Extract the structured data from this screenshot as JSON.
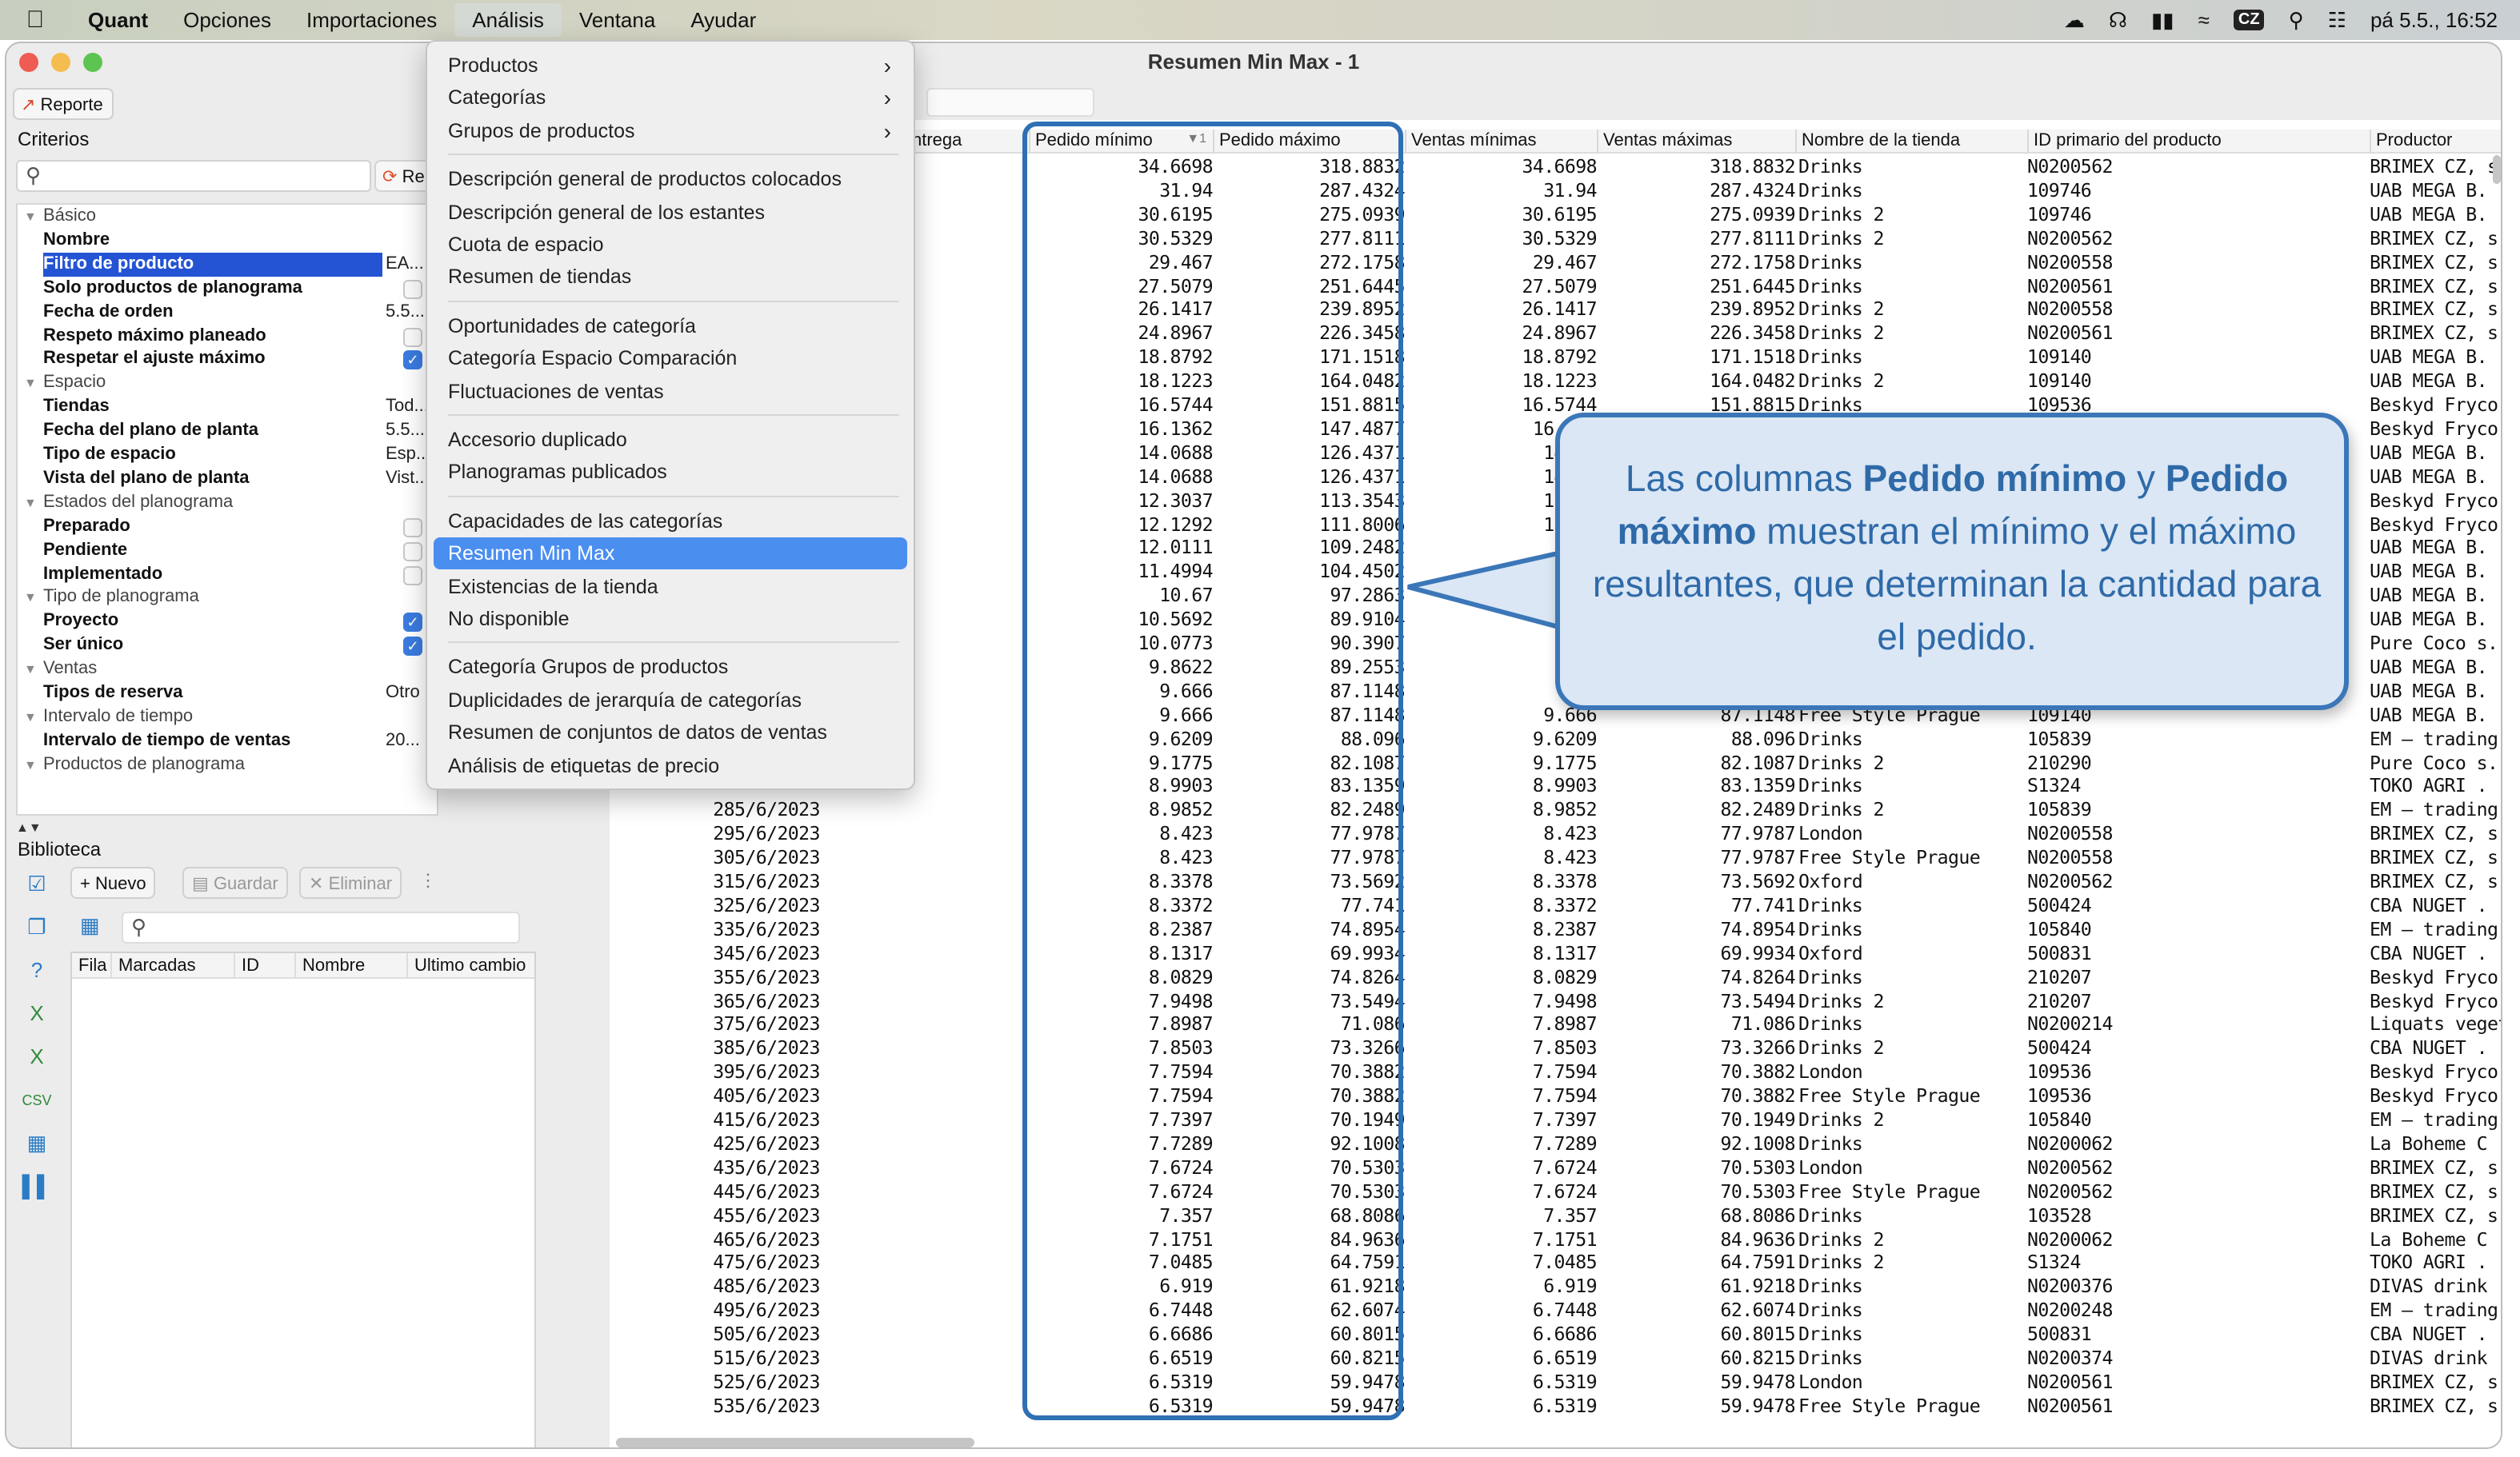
{
  "menubar": {
    "app": "Quant",
    "items": [
      "Opciones",
      "Importaciones",
      "Análisis",
      "Ventana",
      "Ayudar"
    ],
    "active_index": 2,
    "clock": "pá 5.5., 16:52",
    "lang": "CZ"
  },
  "window": {
    "title": "Resumen Min Max - 1",
    "report_button": "Reporte"
  },
  "criteria": {
    "title": "Criterios",
    "re_button": "Re",
    "rows": [
      {
        "type": "group",
        "label": "Básico"
      },
      {
        "type": "item",
        "label": "Nombre",
        "value": ""
      },
      {
        "type": "item",
        "label": "Filtro de producto",
        "value": "EA...",
        "selected": true
      },
      {
        "type": "item",
        "label": "Solo productos de planograma",
        "check": "off"
      },
      {
        "type": "item",
        "label": "Fecha de orden",
        "value": "5.5...."
      },
      {
        "type": "item",
        "label": "Respeto máximo planeado",
        "check": "off"
      },
      {
        "type": "item",
        "label": "Respetar el ajuste máximo",
        "check": "on"
      },
      {
        "type": "group",
        "label": "Espacio"
      },
      {
        "type": "item",
        "label": "Tiendas",
        "value": "Tod..."
      },
      {
        "type": "item",
        "label": "Fecha del plano de planta",
        "value": "5.5...."
      },
      {
        "type": "item",
        "label": "Tipo de espacio",
        "value": "Esp..."
      },
      {
        "type": "item",
        "label": "Vista del plano de planta",
        "value": "Vist..."
      },
      {
        "type": "group",
        "label": "Estados del planograma"
      },
      {
        "type": "item",
        "label": "Preparado",
        "check": "off"
      },
      {
        "type": "item",
        "label": "Pendiente",
        "check": "off"
      },
      {
        "type": "item",
        "label": "Implementado",
        "check": "off"
      },
      {
        "type": "group",
        "label": "Tipo de planograma"
      },
      {
        "type": "item",
        "label": "Proyecto",
        "check": "on"
      },
      {
        "type": "item",
        "label": "Ser único",
        "check": "on"
      },
      {
        "type": "group",
        "label": "Ventas"
      },
      {
        "type": "item",
        "label": "Tipos de reserva",
        "value": "Otro"
      },
      {
        "type": "group",
        "label": "Intervalo de tiempo"
      },
      {
        "type": "item",
        "label": "Intervalo de tiempo de ventas",
        "value": "20..."
      },
      {
        "type": "group",
        "label": "Productos de planograma"
      }
    ]
  },
  "library": {
    "title": "Biblioteca",
    "new_label": "Nuevo",
    "save_label": "Guardar",
    "delete_label": "Eliminar",
    "columns": [
      "Fila",
      "Marcadas",
      "ID",
      "Nombre",
      "Ultimo cambio"
    ]
  },
  "menu": {
    "groups": [
      [
        {
          "label": "Productos",
          "sub": true
        },
        {
          "label": "Categorías",
          "sub": true
        },
        {
          "label": "Grupos de productos",
          "sub": true
        }
      ],
      [
        {
          "label": "Descripción general de productos colocados"
        },
        {
          "label": "Descripción general de los estantes"
        },
        {
          "label": "Cuota de espacio"
        },
        {
          "label": "Resumen de tiendas"
        }
      ],
      [
        {
          "label": "Oportunidades de categoría"
        },
        {
          "label": "Categoría Espacio Comparación"
        },
        {
          "label": "Fluctuaciones de ventas"
        }
      ],
      [
        {
          "label": "Accesorio duplicado"
        },
        {
          "label": "Planogramas publicados"
        }
      ],
      [
        {
          "label": "Capacidades de las categorías"
        },
        {
          "label": "Resumen Min Max",
          "highlight": true
        },
        {
          "label": "Existencias de la tienda"
        },
        {
          "label": "No disponible"
        }
      ],
      [
        {
          "label": "Categoría Grupos de productos"
        },
        {
          "label": "Duplicidades de jerarquía de categorías"
        },
        {
          "label": "Resumen de conjuntos de datos de ventas"
        },
        {
          "label": "Análisis de etiquetas de precio"
        }
      ]
    ]
  },
  "table": {
    "columns": [
      "",
      "ntrega",
      "Pedido mínimo",
      "Pedido máximo",
      "Ventas mínimas",
      "Ventas máximas",
      "Nombre de la tienda",
      "ID primario del producto",
      "Productor"
    ],
    "sort_indicator": "1",
    "rows": [
      [
        "",
        "",
        "34.6698",
        "318.8832",
        "34.6698",
        "318.8832",
        "Drinks",
        "N0200562",
        "BRIMEX CZ, s"
      ],
      [
        "",
        "",
        "31.94",
        "287.4324",
        "31.94",
        "287.4324",
        "Drinks",
        "109746",
        "UAB MEGA B."
      ],
      [
        "",
        "",
        "30.6195",
        "275.0939",
        "30.6195",
        "275.0939",
        "Drinks 2",
        "109746",
        "UAB MEGA B."
      ],
      [
        "",
        "",
        "30.5329",
        "277.8111",
        "30.5329",
        "277.8111",
        "Drinks 2",
        "N0200562",
        "BRIMEX CZ, s"
      ],
      [
        "",
        "",
        "29.467",
        "272.1758",
        "29.467",
        "272.1758",
        "Drinks",
        "N0200558",
        "BRIMEX CZ, s"
      ],
      [
        "",
        "",
        "27.5079",
        "251.6445",
        "27.5079",
        "251.6445",
        "Drinks",
        "N0200561",
        "BRIMEX CZ, s"
      ],
      [
        "",
        "",
        "26.1417",
        "239.8952",
        "26.1417",
        "239.8952",
        "Drinks 2",
        "N0200558",
        "BRIMEX CZ, s"
      ],
      [
        "",
        "",
        "24.8967",
        "226.3458",
        "24.8967",
        "226.3458",
        "Drinks 2",
        "N0200561",
        "BRIMEX CZ, s"
      ],
      [
        "",
        "",
        "18.8792",
        "171.1518",
        "18.8792",
        "171.1518",
        "Drinks",
        "109140",
        "UAB MEGA B."
      ],
      [
        "",
        "",
        "18.1223",
        "164.0482",
        "18.1223",
        "164.0482",
        "Drinks 2",
        "109140",
        "UAB MEGA B."
      ],
      [
        "",
        "",
        "16.5744",
        "151.8815",
        "16.5744",
        "151.8815",
        "Drinks",
        "109536",
        "Beskyd Fryco"
      ],
      [
        "",
        "",
        "16.1362",
        "147.4877",
        "16.136",
        "",
        "",
        "",
        "Beskyd Fryco"
      ],
      [
        "",
        "",
        "14.0688",
        "126.4371",
        "14.06",
        "",
        "",
        "",
        "UAB MEGA B."
      ],
      [
        "",
        "",
        "14.0688",
        "126.4371",
        "14.06",
        "",
        "",
        "",
        "UAB MEGA B."
      ],
      [
        "",
        "",
        "12.3037",
        "113.3543",
        "12.30",
        "",
        "",
        "",
        "Beskyd Fryco"
      ],
      [
        "",
        "",
        "12.1292",
        "111.8006",
        "12.12",
        "",
        "",
        "",
        "Beskyd Fryco"
      ],
      [
        "",
        "",
        "12.0111",
        "109.2482",
        "12.0",
        "",
        "",
        "",
        "UAB MEGA B."
      ],
      [
        "",
        "",
        "11.4994",
        "104.4502",
        "11.4",
        "",
        "",
        "",
        "UAB MEGA B."
      ],
      [
        "",
        "",
        "10.67",
        "97.2863",
        "",
        "",
        "",
        "",
        "UAB MEGA B."
      ],
      [
        "",
        "",
        "10.5692",
        "89.9104",
        "",
        "",
        "",
        "",
        "UAB MEGA B."
      ],
      [
        "",
        "",
        "10.0773",
        "90.3907",
        "",
        "",
        "",
        "",
        "Pure Coco s."
      ],
      [
        "",
        "",
        "9.8622",
        "89.2553",
        "9.8",
        "",
        "",
        "",
        "UAB MEGA B."
      ],
      [
        "",
        "",
        "9.666",
        "87.1148",
        "9.6",
        "",
        "",
        "",
        "UAB MEGA B."
      ],
      [
        "",
        "",
        "9.666",
        "87.1148",
        "9.666",
        "87.1148",
        "Free Style Prague",
        "109140",
        "UAB MEGA B."
      ],
      [
        "",
        "",
        "9.6209",
        "88.096",
        "9.6209",
        "88.096",
        "Drinks",
        "105839",
        "EM – trading"
      ],
      [
        "",
        "",
        "9.1775",
        "82.1087",
        "9.1775",
        "82.1087",
        "Drinks 2",
        "210290",
        "Pure Coco s."
      ],
      [
        "",
        "",
        "8.9903",
        "83.1359",
        "8.9903",
        "83.1359",
        "Drinks",
        "S1324",
        "TOKO AGRI ."
      ],
      [
        "28",
        "5/6/2023",
        "8.9852",
        "82.2489",
        "8.9852",
        "82.2489",
        "Drinks 2",
        "105839",
        "EM – trading"
      ],
      [
        "29",
        "5/6/2023",
        "8.423",
        "77.9787",
        "8.423",
        "77.9787",
        "London",
        "N0200558",
        "BRIMEX CZ, s"
      ],
      [
        "30",
        "5/6/2023",
        "8.423",
        "77.9787",
        "8.423",
        "77.9787",
        "Free Style Prague",
        "N0200558",
        "BRIMEX CZ, s"
      ],
      [
        "31",
        "5/6/2023",
        "8.3378",
        "73.5692",
        "8.3378",
        "73.5692",
        "Oxford",
        "N0200562",
        "BRIMEX CZ, s"
      ],
      [
        "32",
        "5/6/2023",
        "8.3372",
        "77.741",
        "8.3372",
        "77.741",
        "Drinks",
        "500424",
        "CBA NUGET ."
      ],
      [
        "33",
        "5/6/2023",
        "8.2387",
        "74.8954",
        "8.2387",
        "74.8954",
        "Drinks",
        "105840",
        "EM – trading"
      ],
      [
        "34",
        "5/6/2023",
        "8.1317",
        "69.9934",
        "8.1317",
        "69.9934",
        "Oxford",
        "500831",
        "CBA NUGET ."
      ],
      [
        "35",
        "5/6/2023",
        "8.0829",
        "74.8264",
        "8.0829",
        "74.8264",
        "Drinks",
        "210207",
        "Beskyd Fryco"
      ],
      [
        "36",
        "5/6/2023",
        "7.9498",
        "73.5494",
        "7.9498",
        "73.5494",
        "Drinks 2",
        "210207",
        "Beskyd Fryco"
      ],
      [
        "37",
        "5/6/2023",
        "7.8987",
        "71.086",
        "7.8987",
        "71.086",
        "Drinks",
        "N0200214",
        "Liquats veget"
      ],
      [
        "38",
        "5/6/2023",
        "7.8503",
        "73.3266",
        "7.8503",
        "73.3266",
        "Drinks 2",
        "500424",
        "CBA NUGET ."
      ],
      [
        "39",
        "5/6/2023",
        "7.7594",
        "70.3882",
        "7.7594",
        "70.3882",
        "London",
        "109536",
        "Beskyd Fryco"
      ],
      [
        "40",
        "5/6/2023",
        "7.7594",
        "70.3882",
        "7.7594",
        "70.3882",
        "Free Style Prague",
        "109536",
        "Beskyd Fryco"
      ],
      [
        "41",
        "5/6/2023",
        "7.7397",
        "70.1949",
        "7.7397",
        "70.1949",
        "Drinks 2",
        "105840",
        "EM – trading"
      ],
      [
        "42",
        "5/6/2023",
        "7.7289",
        "92.1008",
        "7.7289",
        "92.1008",
        "Drinks",
        "N0200062",
        "La Boheme C"
      ],
      [
        "43",
        "5/6/2023",
        "7.6724",
        "70.5303",
        "7.6724",
        "70.5303",
        "London",
        "N0200562",
        "BRIMEX CZ, s"
      ],
      [
        "44",
        "5/6/2023",
        "7.6724",
        "70.5303",
        "7.6724",
        "70.5303",
        "Free Style Prague",
        "N0200562",
        "BRIMEX CZ, s"
      ],
      [
        "45",
        "5/6/2023",
        "7.357",
        "68.8086",
        "7.357",
        "68.8086",
        "Drinks",
        "103528",
        "BRIMEX CZ, s"
      ],
      [
        "46",
        "5/6/2023",
        "7.1751",
        "84.9636",
        "7.1751",
        "84.9636",
        "Drinks 2",
        "N0200062",
        "La Boheme C"
      ],
      [
        "47",
        "5/6/2023",
        "7.0485",
        "64.7591",
        "7.0485",
        "64.7591",
        "Drinks 2",
        "S1324",
        "TOKO AGRI ."
      ],
      [
        "48",
        "5/6/2023",
        "6.919",
        "61.9218",
        "6.919",
        "61.9218",
        "Drinks",
        "N0200376",
        "DIVAS drink"
      ],
      [
        "49",
        "5/6/2023",
        "6.7448",
        "62.6074",
        "6.7448",
        "62.6074",
        "Drinks",
        "N0200248",
        "EM – trading"
      ],
      [
        "50",
        "5/6/2023",
        "6.6686",
        "60.8015",
        "6.6686",
        "60.8015",
        "Drinks",
        "500831",
        "CBA NUGET ."
      ],
      [
        "51",
        "5/6/2023",
        "6.6519",
        "60.8215",
        "6.6519",
        "60.8215",
        "Drinks",
        "N0200374",
        "DIVAS drink"
      ],
      [
        "52",
        "5/6/2023",
        "6.5319",
        "59.9478",
        "6.5319",
        "59.9478",
        "London",
        "N0200561",
        "BRIMEX CZ, s"
      ],
      [
        "53",
        "5/6/2023",
        "6.5319",
        "59.9478",
        "6.5319",
        "59.9478",
        "Free Style Prague",
        "N0200561",
        "BRIMEX CZ, s"
      ]
    ]
  },
  "callout": {
    "pre": "Las columnas ",
    "bold1": "Pedido mínimo",
    "mid": " y ",
    "bold2": "Pedido máximo",
    "post": " muestran el mínimo y el máximo resultantes, que determinan la cantidad para el pedido."
  },
  "colors": {
    "highlight_border": "#2f6fb4",
    "callout_fill": "#dbe7f5",
    "menu_highlight": "#4a8ef0",
    "selected_row": "#2454d4"
  }
}
